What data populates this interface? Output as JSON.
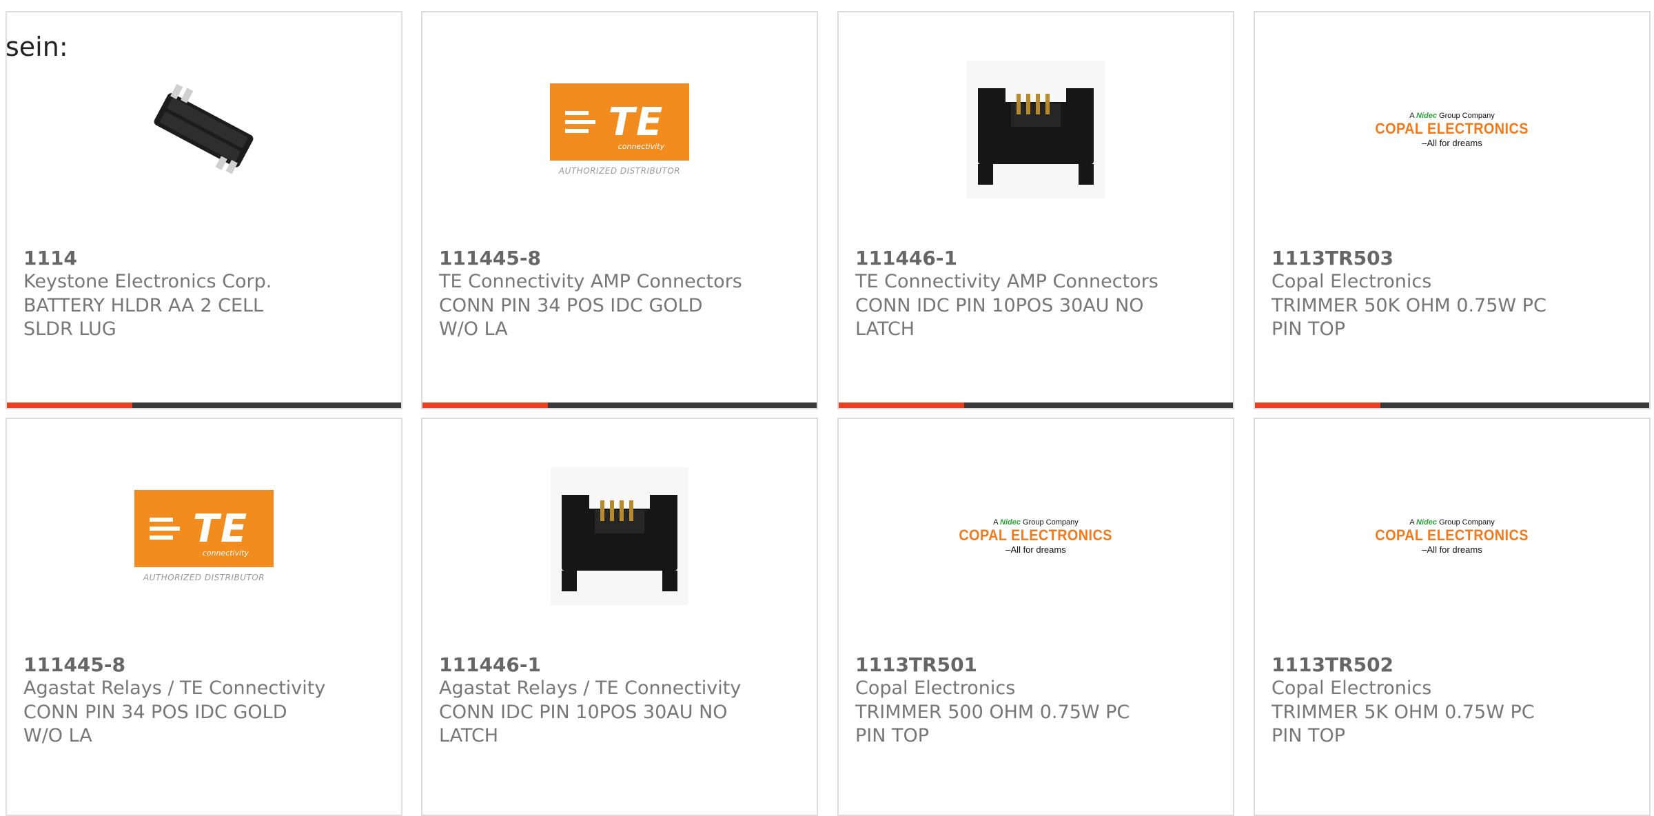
{
  "intro_text": "sein:",
  "colors": {
    "accent": "#e8411f",
    "bar": "#3a3a3a",
    "te_orange": "#f28c1e",
    "copal_orange": "#f07a1e"
  },
  "cards": [
    {
      "part_number": "1114",
      "manufacturer": "Keystone Electronics Corp.",
      "description": "BATTERY HLDR AA 2 CELL SLDR LUG",
      "image": "battery-holder-image"
    },
    {
      "part_number": "111445-8",
      "manufacturer": "TE Connectivity AMP Connectors",
      "description": "CONN PIN 34 POS IDC GOLD W/O LA",
      "image": "te-logo",
      "logo": {
        "mark": "TE",
        "sub": "connectivity",
        "caption": "AUTHORIZED DISTRIBUTOR"
      }
    },
    {
      "part_number": "111446-1",
      "manufacturer": "TE Connectivity AMP Connectors",
      "description": "CONN IDC PIN 10POS 30AU NO LATCH",
      "image": "idc-connector-image"
    },
    {
      "part_number": "1113TR503",
      "manufacturer": "Copal Electronics",
      "description": "TRIMMER 50K OHM 0.75W PC PIN TOP",
      "image": "copal-logo",
      "logo": {
        "pre": "A",
        "nid": "Nidec",
        "post": "Group Company",
        "name": "COPAL ELECTRONICS",
        "tag": "–All for dreams"
      }
    },
    {
      "part_number": "111445-8",
      "manufacturer": "Agastat Relays / TE Connectivity",
      "description": "CONN PIN 34 POS IDC GOLD W/O LA",
      "image": "te-logo",
      "logo": {
        "mark": "TE",
        "sub": "connectivity",
        "caption": "AUTHORIZED DISTRIBUTOR"
      }
    },
    {
      "part_number": "111446-1",
      "manufacturer": "Agastat Relays / TE Connectivity",
      "description": "CONN IDC PIN 10POS 30AU NO LATCH",
      "image": "idc-connector-image"
    },
    {
      "part_number": "1113TR501",
      "manufacturer": "Copal Electronics",
      "description": "TRIMMER 500 OHM 0.75W PC PIN TOP",
      "image": "copal-logo",
      "logo": {
        "pre": "A",
        "nid": "Nidec",
        "post": "Group Company",
        "name": "COPAL ELECTRONICS",
        "tag": "–All for dreams"
      }
    },
    {
      "part_number": "1113TR502",
      "manufacturer": "Copal Electronics",
      "description": "TRIMMER 5K OHM 0.75W PC PIN TOP",
      "image": "copal-logo",
      "logo": {
        "pre": "A",
        "nid": "Nidec",
        "post": "Group Company",
        "name": "COPAL ELECTRONICS",
        "tag": "–All for dreams"
      }
    }
  ]
}
